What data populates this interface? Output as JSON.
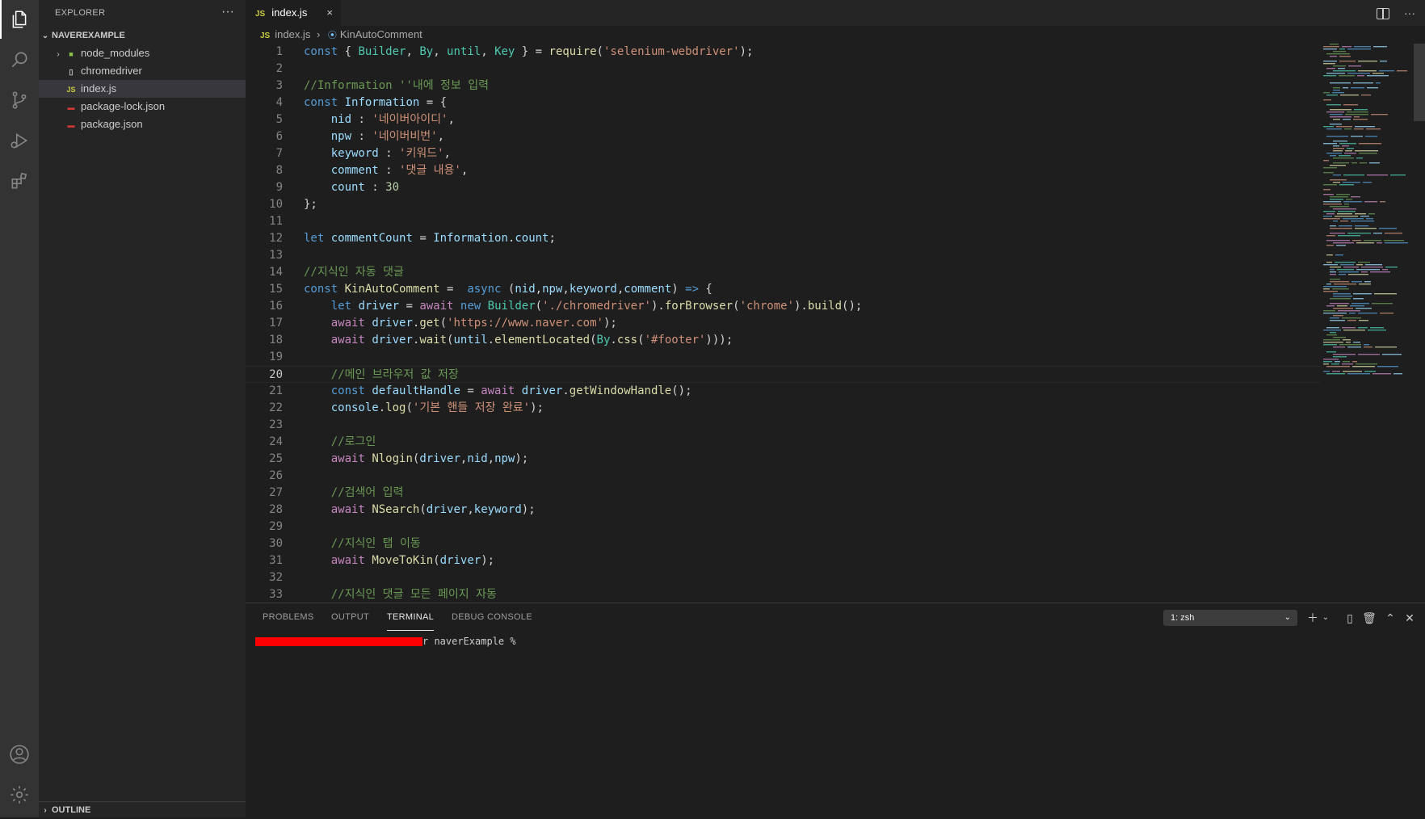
{
  "explorer": {
    "title": "EXPLORER",
    "more": "···",
    "folder": "NAVEREXAMPLE",
    "items": [
      {
        "label": "node_modules",
        "icon": "folder-icon"
      },
      {
        "label": "chromedriver",
        "icon": "file-icon"
      },
      {
        "label": "index.js",
        "icon": "js-file-icon",
        "badge": "JS"
      },
      {
        "label": "package-lock.json",
        "icon": "json-file-icon"
      },
      {
        "label": "package.json",
        "icon": "json-file-icon"
      }
    ],
    "outline": "OUTLINE"
  },
  "tab": {
    "badge": "JS",
    "label": "index.js",
    "close": "×"
  },
  "breadcrumb": {
    "badge": "JS",
    "file": "index.js",
    "sep": "›",
    "symbol": "KinAutoComment"
  },
  "editor": {
    "current_line": 20,
    "lines": [
      {
        "n": "1",
        "tokens": [
          [
            "kw",
            "const"
          ],
          [
            "p",
            " { "
          ],
          [
            "t",
            "Builder"
          ],
          [
            "p",
            ", "
          ],
          [
            "t",
            "By"
          ],
          [
            "p",
            ", "
          ],
          [
            "t",
            "until"
          ],
          [
            "p",
            ", "
          ],
          [
            "t",
            "Key"
          ],
          [
            "p",
            " } = "
          ],
          [
            "f",
            "require"
          ],
          [
            "p",
            "("
          ],
          [
            "s",
            "'selenium-webdriver'"
          ],
          [
            "p",
            ");"
          ]
        ]
      },
      {
        "n": "2",
        "tokens": []
      },
      {
        "n": "3",
        "tokens": [
          [
            "c",
            "//Information ''내에 정보 입력"
          ]
        ]
      },
      {
        "n": "4",
        "tokens": [
          [
            "kw",
            "const"
          ],
          [
            "p",
            " "
          ],
          [
            "v",
            "Information"
          ],
          [
            "p",
            " = {"
          ]
        ]
      },
      {
        "n": "5",
        "tokens": [
          [
            "p",
            "    "
          ],
          [
            "v",
            "nid"
          ],
          [
            "p",
            " : "
          ],
          [
            "s",
            "'네이버아이디'"
          ],
          [
            "p",
            ","
          ]
        ]
      },
      {
        "n": "6",
        "tokens": [
          [
            "p",
            "    "
          ],
          [
            "v",
            "npw"
          ],
          [
            "p",
            " : "
          ],
          [
            "s",
            "'네이버비번'"
          ],
          [
            "p",
            ","
          ]
        ]
      },
      {
        "n": "7",
        "tokens": [
          [
            "p",
            "    "
          ],
          [
            "v",
            "keyword"
          ],
          [
            "p",
            " : "
          ],
          [
            "s",
            "'키워드'"
          ],
          [
            "p",
            ","
          ]
        ]
      },
      {
        "n": "8",
        "tokens": [
          [
            "p",
            "    "
          ],
          [
            "v",
            "comment"
          ],
          [
            "p",
            " : "
          ],
          [
            "s",
            "'댓글 내용'"
          ],
          [
            "p",
            ","
          ]
        ]
      },
      {
        "n": "9",
        "tokens": [
          [
            "p",
            "    "
          ],
          [
            "v",
            "count"
          ],
          [
            "p",
            " : "
          ],
          [
            "n",
            "30"
          ]
        ]
      },
      {
        "n": "10",
        "tokens": [
          [
            "p",
            "};"
          ]
        ]
      },
      {
        "n": "11",
        "tokens": []
      },
      {
        "n": "12",
        "tokens": [
          [
            "kw",
            "let"
          ],
          [
            "p",
            " "
          ],
          [
            "v",
            "commentCount"
          ],
          [
            "p",
            " = "
          ],
          [
            "v",
            "Information"
          ],
          [
            "p",
            "."
          ],
          [
            "v",
            "count"
          ],
          [
            "p",
            ";"
          ]
        ]
      },
      {
        "n": "13",
        "tokens": []
      },
      {
        "n": "14",
        "tokens": [
          [
            "c",
            "//지식인 자동 댓글"
          ]
        ]
      },
      {
        "n": "15",
        "tokens": [
          [
            "kw",
            "const"
          ],
          [
            "p",
            " "
          ],
          [
            "f",
            "KinAutoComment"
          ],
          [
            "p",
            " =  "
          ],
          [
            "kw",
            "async"
          ],
          [
            "p",
            " ("
          ],
          [
            "v",
            "nid"
          ],
          [
            "p",
            ","
          ],
          [
            "v",
            "npw"
          ],
          [
            "p",
            ","
          ],
          [
            "v",
            "keyword"
          ],
          [
            "p",
            ","
          ],
          [
            "v",
            "comment"
          ],
          [
            "p",
            ") "
          ],
          [
            "kw",
            "=>"
          ],
          [
            "p",
            " {"
          ]
        ]
      },
      {
        "n": "16",
        "tokens": [
          [
            "p",
            "    "
          ],
          [
            "kw",
            "let"
          ],
          [
            "p",
            " "
          ],
          [
            "v",
            "driver"
          ],
          [
            "p",
            " = "
          ],
          [
            "k2",
            "await"
          ],
          [
            "p",
            " "
          ],
          [
            "kw",
            "new"
          ],
          [
            "p",
            " "
          ],
          [
            "t",
            "Builder"
          ],
          [
            "p",
            "("
          ],
          [
            "s",
            "'./chromedriver'"
          ],
          [
            "p",
            ")."
          ],
          [
            "f",
            "forBrowser"
          ],
          [
            "p",
            "("
          ],
          [
            "s",
            "'chrome'"
          ],
          [
            "p",
            ")."
          ],
          [
            "f",
            "build"
          ],
          [
            "p",
            "();"
          ]
        ]
      },
      {
        "n": "17",
        "tokens": [
          [
            "p",
            "    "
          ],
          [
            "k2",
            "await"
          ],
          [
            "p",
            " "
          ],
          [
            "v",
            "driver"
          ],
          [
            "p",
            "."
          ],
          [
            "f",
            "get"
          ],
          [
            "p",
            "("
          ],
          [
            "s",
            "'https://www.naver.com'"
          ],
          [
            "p",
            ");"
          ]
        ]
      },
      {
        "n": "18",
        "tokens": [
          [
            "p",
            "    "
          ],
          [
            "k2",
            "await"
          ],
          [
            "p",
            " "
          ],
          [
            "v",
            "driver"
          ],
          [
            "p",
            "."
          ],
          [
            "f",
            "wait"
          ],
          [
            "p",
            "("
          ],
          [
            "v",
            "until"
          ],
          [
            "p",
            "."
          ],
          [
            "f",
            "elementLocated"
          ],
          [
            "p",
            "("
          ],
          [
            "t",
            "By"
          ],
          [
            "p",
            "."
          ],
          [
            "f",
            "css"
          ],
          [
            "p",
            "("
          ],
          [
            "s",
            "'#footer'"
          ],
          [
            "p",
            ")));"
          ]
        ]
      },
      {
        "n": "19",
        "tokens": []
      },
      {
        "n": "20",
        "tokens": [
          [
            "p",
            "    "
          ],
          [
            "c",
            "//메인 브라우저 값 저장"
          ]
        ]
      },
      {
        "n": "21",
        "tokens": [
          [
            "p",
            "    "
          ],
          [
            "kw",
            "const"
          ],
          [
            "p",
            " "
          ],
          [
            "v",
            "defaultHandle"
          ],
          [
            "p",
            " = "
          ],
          [
            "k2",
            "await"
          ],
          [
            "p",
            " "
          ],
          [
            "v",
            "driver"
          ],
          [
            "p",
            "."
          ],
          [
            "f",
            "getWindowHandle"
          ],
          [
            "p",
            "();"
          ]
        ]
      },
      {
        "n": "22",
        "tokens": [
          [
            "p",
            "    "
          ],
          [
            "v",
            "console"
          ],
          [
            "p",
            "."
          ],
          [
            "f",
            "log"
          ],
          [
            "p",
            "("
          ],
          [
            "s",
            "'기본 핸들 저장 완료'"
          ],
          [
            "p",
            ");"
          ]
        ]
      },
      {
        "n": "23",
        "tokens": []
      },
      {
        "n": "24",
        "tokens": [
          [
            "p",
            "    "
          ],
          [
            "c",
            "//로그인"
          ]
        ]
      },
      {
        "n": "25",
        "tokens": [
          [
            "p",
            "    "
          ],
          [
            "k2",
            "await"
          ],
          [
            "p",
            " "
          ],
          [
            "f",
            "Nlogin"
          ],
          [
            "p",
            "("
          ],
          [
            "v",
            "driver"
          ],
          [
            "p",
            ","
          ],
          [
            "v",
            "nid"
          ],
          [
            "p",
            ","
          ],
          [
            "v",
            "npw"
          ],
          [
            "p",
            ");"
          ]
        ]
      },
      {
        "n": "26",
        "tokens": []
      },
      {
        "n": "27",
        "tokens": [
          [
            "p",
            "    "
          ],
          [
            "c",
            "//검색어 입력"
          ]
        ]
      },
      {
        "n": "28",
        "tokens": [
          [
            "p",
            "    "
          ],
          [
            "k2",
            "await"
          ],
          [
            "p",
            " "
          ],
          [
            "f",
            "NSearch"
          ],
          [
            "p",
            "("
          ],
          [
            "v",
            "driver"
          ],
          [
            "p",
            ","
          ],
          [
            "v",
            "keyword"
          ],
          [
            "p",
            ");"
          ]
        ]
      },
      {
        "n": "29",
        "tokens": []
      },
      {
        "n": "30",
        "tokens": [
          [
            "p",
            "    "
          ],
          [
            "c",
            "//지식인 탭 이동"
          ]
        ]
      },
      {
        "n": "31",
        "tokens": [
          [
            "p",
            "    "
          ],
          [
            "k2",
            "await"
          ],
          [
            "p",
            " "
          ],
          [
            "f",
            "MoveToKin"
          ],
          [
            "p",
            "("
          ],
          [
            "v",
            "driver"
          ],
          [
            "p",
            ");"
          ]
        ]
      },
      {
        "n": "32",
        "tokens": []
      },
      {
        "n": "33",
        "tokens": [
          [
            "p",
            "    "
          ],
          [
            "c",
            "//지식인 댓글 모든 페이지 자동"
          ]
        ]
      }
    ]
  },
  "panel": {
    "tabs": [
      "PROBLEMS",
      "OUTPUT",
      "TERMINAL",
      "DEBUG CONSOLE"
    ],
    "active_tab": "TERMINAL",
    "terminal_select": "1: zsh",
    "prompt_suffix": "r naverExample %"
  },
  "colors": {
    "accent": "#007acc",
    "redaction": "#ff0000"
  }
}
